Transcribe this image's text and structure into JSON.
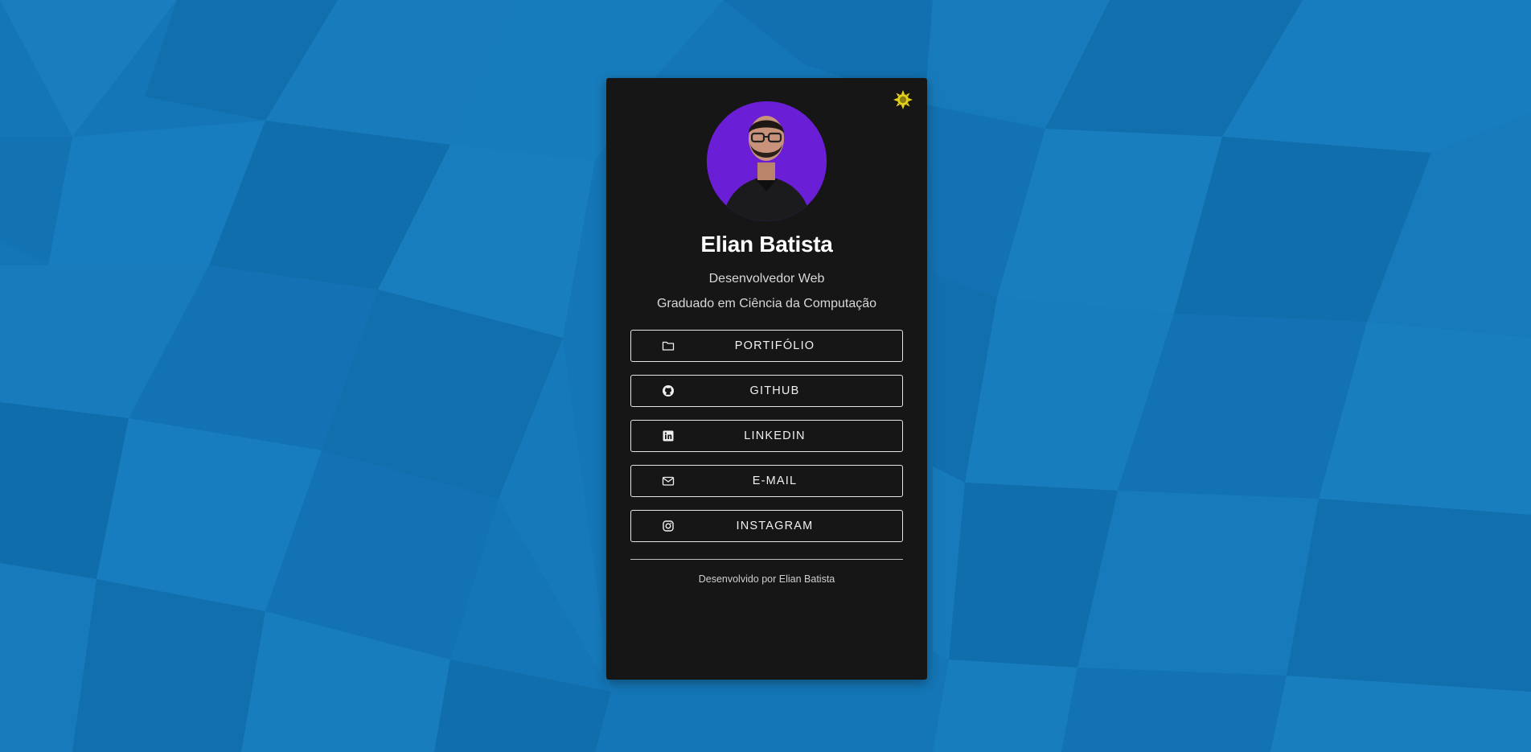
{
  "colors": {
    "background": "#1476b6",
    "card": "#161616",
    "accent_sun": "#e5d21a",
    "avatar_bg": "#6a1fd6",
    "text": "#ffffff",
    "button_border": "#e6e6e6"
  },
  "header": {
    "theme_toggle_icon": "sun-icon",
    "avatar": "profile-photo"
  },
  "profile": {
    "name": "Elian Batista",
    "role": "Desenvolvedor Web",
    "degree": "Graduado em Ciência da Computação"
  },
  "links": [
    {
      "label": "PORTIFÓLIO",
      "icon": "folder-icon"
    },
    {
      "label": "GITHUB",
      "icon": "github-icon"
    },
    {
      "label": "LINKEDIN",
      "icon": "linkedin-icon"
    },
    {
      "label": "E-MAIL",
      "icon": "envelope-icon"
    },
    {
      "label": "INSTAGRAM",
      "icon": "instagram-icon"
    }
  ],
  "footer": {
    "text": "Desenvolvido por Elian Batista"
  }
}
